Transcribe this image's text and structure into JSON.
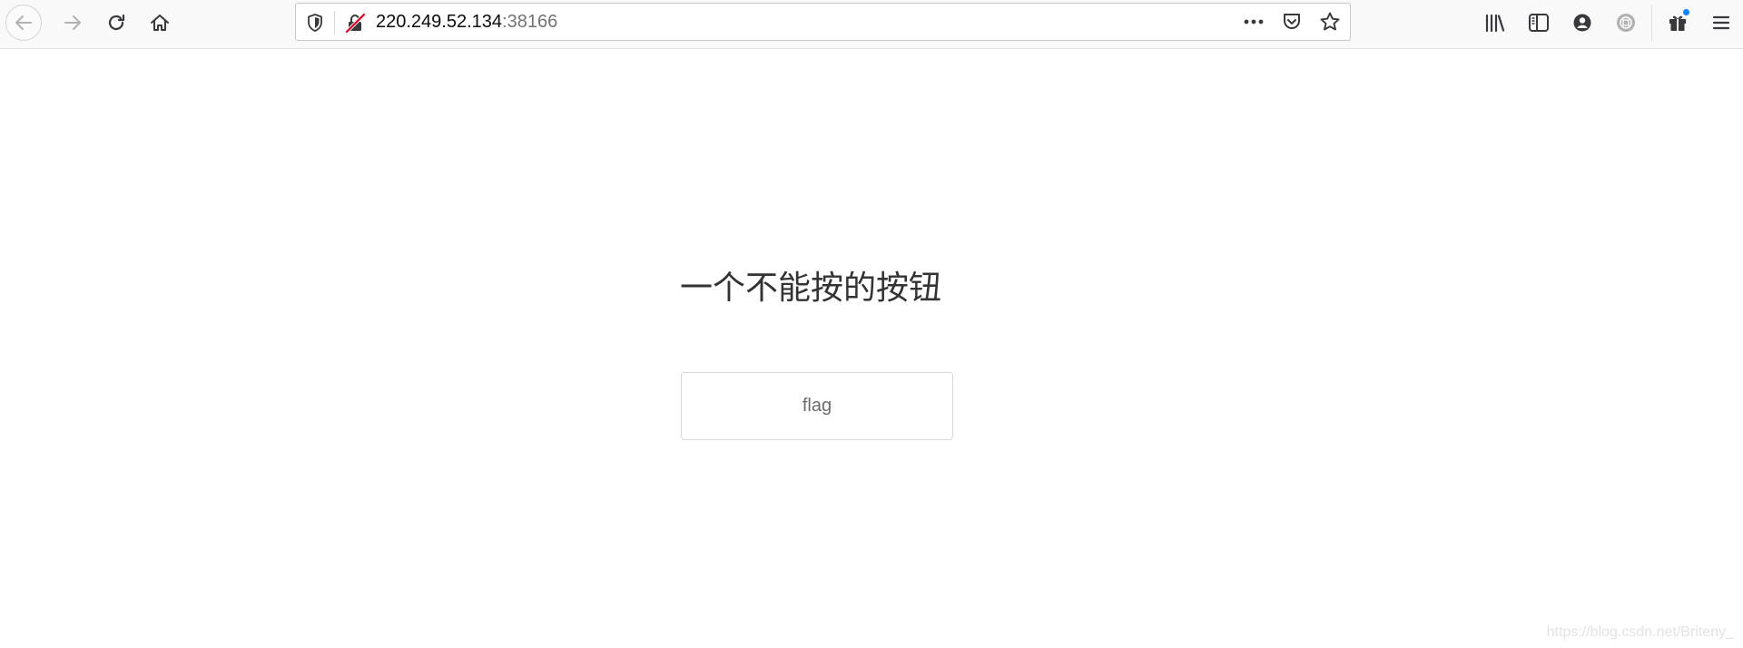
{
  "browser": {
    "url": {
      "host": "220.249.52.134",
      "port": ":38166"
    },
    "icons": {
      "back": "arrow-left-icon",
      "forward": "arrow-right-icon",
      "reload": "reload-icon",
      "home": "home-icon",
      "tracking": "shield-icon",
      "insecure": "insecure-lock-icon",
      "page_actions": "more-horizontal-icon",
      "pocket": "pocket-icon",
      "bookmark": "star-icon",
      "library": "library-icon",
      "sidebar": "sidebar-icon",
      "account": "account-icon",
      "extension": "extension-icon",
      "whats_new": "gift-icon",
      "menu": "hamburger-menu-icon"
    },
    "colors": {
      "toolbar_bg": "#f9f9fa",
      "insecure_red": "#d70022",
      "notification_blue": "#0a84ff"
    }
  },
  "page": {
    "heading": "一个不能按的按钮",
    "button_label": "flag",
    "watermark": "https://blog.csdn.net/Briteny_"
  }
}
